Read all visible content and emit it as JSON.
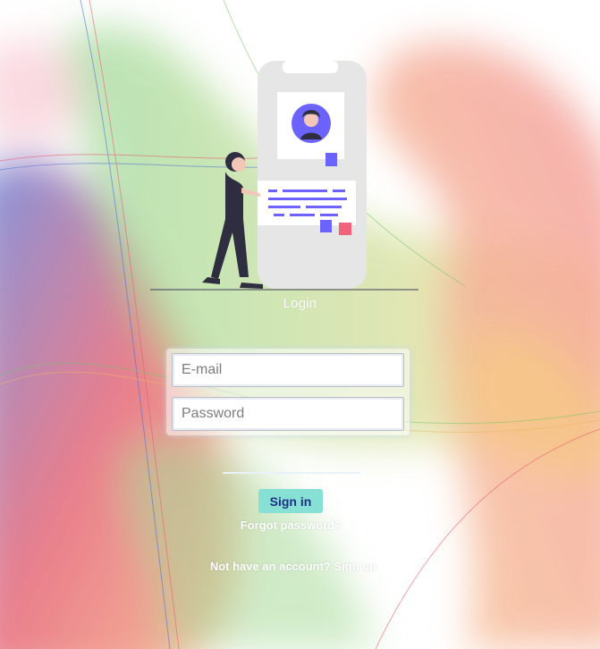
{
  "login": {
    "title": "Login",
    "email_placeholder": "E-mail",
    "password_placeholder": "Password",
    "signin_label": "Sign in",
    "forgot_label": "Forgot password?",
    "no_account_text": "Not have an account?",
    "signup_label": "Sign up"
  },
  "colors": {
    "accent": "#6c63ff",
    "signin_bg": "#86e0d3",
    "signin_text": "#1f2f86",
    "note_pink": "#f2627a"
  },
  "icons": [
    "person-with-phone-illustration"
  ]
}
